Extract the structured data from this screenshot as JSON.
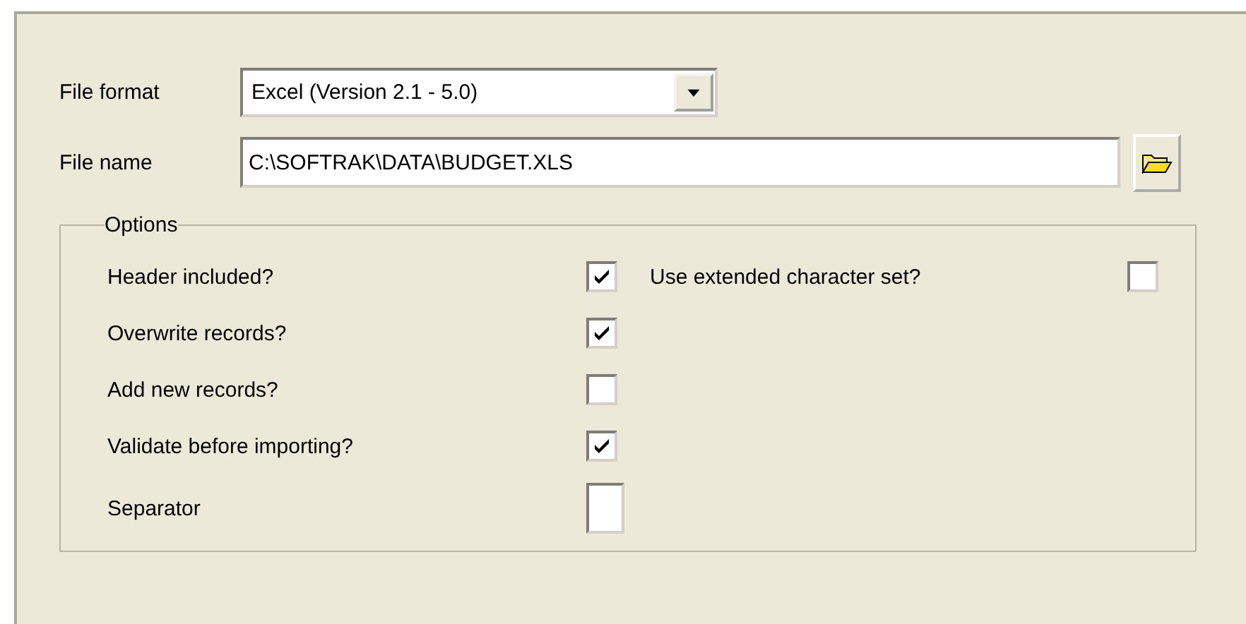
{
  "file_format": {
    "label": "File format",
    "value": "Excel (Version 2.1 - 5.0)"
  },
  "file_name": {
    "label": "File name",
    "value": "C:\\SOFTRAK\\DATA\\BUDGET.XLS"
  },
  "options": {
    "title": "Options",
    "left": [
      {
        "kind": "checkbox",
        "label": "Header included?",
        "checked": true
      },
      {
        "kind": "checkbox",
        "label": "Overwrite records?",
        "checked": true
      },
      {
        "kind": "checkbox",
        "label": "Add new records?",
        "checked": false
      },
      {
        "kind": "checkbox",
        "label": "Validate before importing?",
        "checked": true
      },
      {
        "kind": "field",
        "label": "Separator"
      }
    ],
    "right": [
      {
        "kind": "checkbox",
        "label": "Use extended character set?",
        "checked": false
      }
    ]
  }
}
